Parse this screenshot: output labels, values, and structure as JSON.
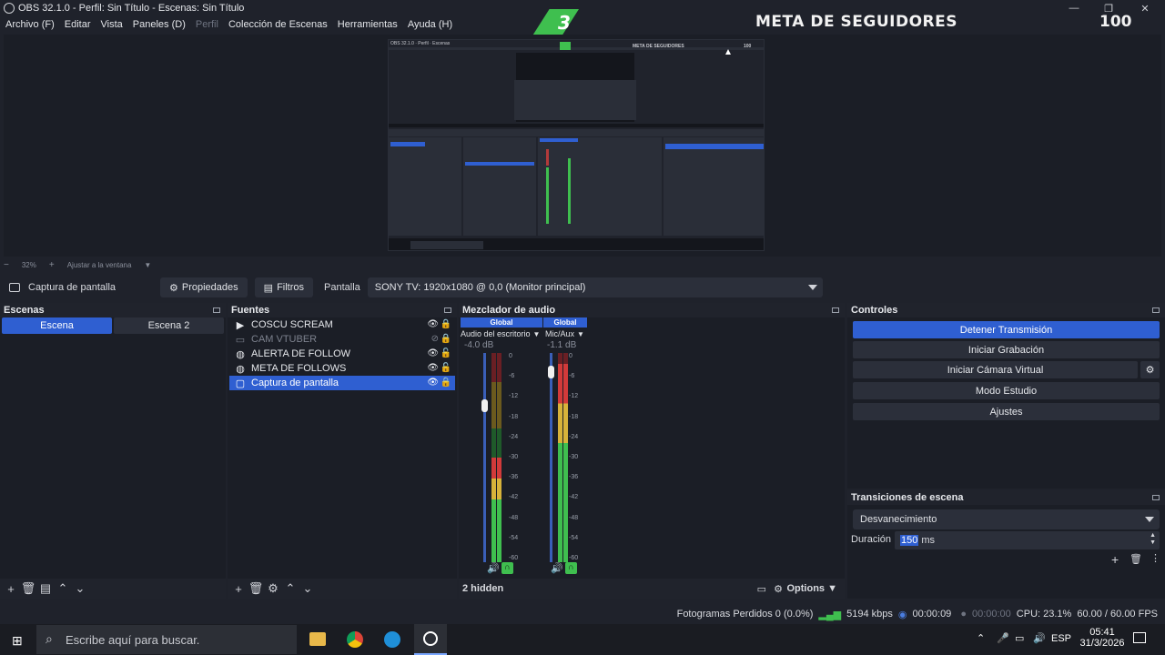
{
  "window": {
    "title": "OBS 32.1.0 - Perfil: Sin Título - Escenas: Sin Título",
    "controls": [
      "minimize-icon",
      "maximize-icon",
      "close-icon"
    ]
  },
  "menu": {
    "items": [
      "Archivo (F)",
      "Editar",
      "Vista",
      "Paneles (D)",
      "Perfil",
      "Colección de Escenas",
      "Herramientas",
      "Ayuda (H)"
    ]
  },
  "overlay": {
    "follower_count": "3",
    "goal_title": "META DE SEGUIDORES",
    "goal_target": "100",
    "accent_color": "#3fbf4f"
  },
  "preview": {
    "zoom": "32%",
    "fit_label": "Ajustar a la ventana"
  },
  "source_toolbar": {
    "selected_source": "Captura de pantalla",
    "properties_label": "Propiedades",
    "filters_label": "Filtros",
    "display_label": "Pantalla",
    "display_value": "SONY TV: 1920x1080 @ 0,0 (Monitor principal)"
  },
  "scenes": {
    "title": "Escenas",
    "items": [
      "Escena",
      "Escena 2"
    ],
    "active_index": 0
  },
  "sources": {
    "title": "Fuentes",
    "items": [
      {
        "name": "COSCU SCREAM",
        "icon": "play-icon",
        "visible": true,
        "locked": true,
        "selected": false
      },
      {
        "name": "CAM VTUBER",
        "icon": "camera-icon",
        "visible": false,
        "locked": true,
        "selected": false
      },
      {
        "name": "ALERTA DE FOLLOW",
        "icon": "globe-icon",
        "visible": true,
        "locked": false,
        "selected": false
      },
      {
        "name": "META DE FOLLOWS",
        "icon": "globe-icon",
        "visible": true,
        "locked": false,
        "selected": false
      },
      {
        "name": "Captura de pantalla",
        "icon": "monitor-icon",
        "visible": true,
        "locked": true,
        "selected": true
      }
    ]
  },
  "mixer": {
    "title": "Mezclador de audio",
    "channels": [
      {
        "badge": "Global",
        "name": "Audio del escritorio",
        "db": "-4.0 dB",
        "level": 0.5,
        "fader": 0.78
      },
      {
        "badge": "Global",
        "name": "Mic/Aux",
        "db": "-1.1 dB",
        "level": 0.95,
        "fader": 0.94
      }
    ],
    "ticks": [
      "0",
      "-6",
      "-12",
      "-18",
      "-24",
      "-30",
      "-36",
      "-42",
      "-48",
      "-54",
      "-60"
    ],
    "hidden_label": "2 hidden",
    "options_label": "Options"
  },
  "controls": {
    "title": "Controles",
    "buttons": [
      "Detener Transmisión",
      "Iniciar Grabación",
      "Iniciar Cámara Virtual",
      "Modo Estudio",
      "Ajustes"
    ],
    "active_color": "#2f5fd1"
  },
  "transitions": {
    "title": "Transiciones de escena",
    "selected": "Desvanecimiento",
    "duration_label": "Duración",
    "duration_value": "150",
    "duration_unit": "ms"
  },
  "status": {
    "dropped_frames": "Fotogramas Perdidos 0 (0.0%)",
    "bitrate": "5194 kbps",
    "stream_time": "00:00:09",
    "record_time": "00:00:00",
    "cpu": "CPU: 23.1%",
    "fps": "60.00 / 60.00 FPS"
  },
  "taskbar": {
    "search_placeholder": "Escribe aquí para buscar.",
    "language": "ESP",
    "time": "05:41",
    "date": "31/3/2026"
  }
}
